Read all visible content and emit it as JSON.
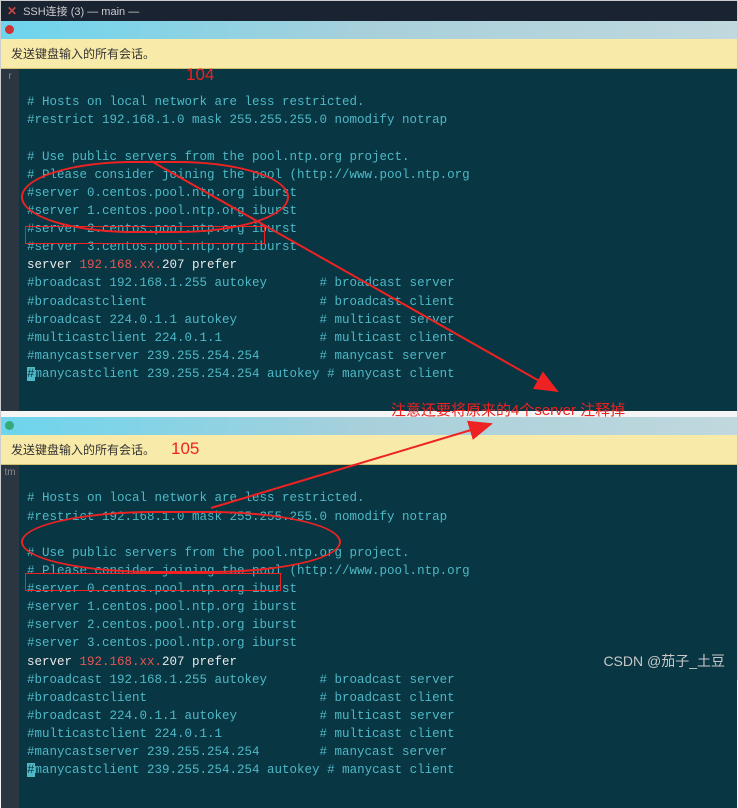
{
  "tab": {
    "title_masked": "SSH连接 (3) — main —"
  },
  "banner": {
    "text": "发送键盘输入的所有会话。"
  },
  "labels": {
    "n104": "104",
    "n105": "105"
  },
  "annotation": {
    "note": "注意还要将原来的4个server 注释掉"
  },
  "term_top": {
    "l1": "# Hosts on local network are less restricted.",
    "l2": "#restrict 192.168.1.0 mask 255.255.255.0 nomodify notrap",
    "l3": "",
    "l4": "# Use public servers from the pool.ntp.org project.",
    "l5": "# Please consider joining the pool (http://www.pool.ntp.org",
    "l6": "#server 0.centos.pool.ntp.org iburst",
    "l7": "#server 1.centos.pool.ntp.org iburst",
    "l8": "#server 2.centos.pool.ntp.org iburst",
    "l9": "#server 3.centos.pool.ntp.org iburst",
    "l10a": "server ",
    "l10b": "192.168.xx.",
    "l10c": "207 prefer",
    "l11": "#broadcast 192.168.1.255 autokey       # broadcast server",
    "l12": "#broadcastclient                       # broadcast client",
    "l13": "#broadcast 224.0.1.1 autokey           # multicast server",
    "l14": "#multicastclient 224.0.1.1             # multicast client",
    "l15": "#manycastserver 239.255.254.254        # manycast server",
    "l16a": "#",
    "l16b": "manycastclient 239.255.254.254 autokey # manycast client"
  },
  "term_bot": {
    "l1": "# Hosts on local network are less restricted.",
    "l2": "#restrict 192.168.1.0 mask 255.255.255.0 nomodify notrap",
    "l3": "",
    "l4": "# Use public servers from the pool.ntp.org project.",
    "l5": "# Please consider joining the pool (http://www.pool.ntp.org",
    "l6": "#server 0.centos.pool.ntp.org iburst",
    "l7": "#server 1.centos.pool.ntp.org iburst",
    "l8": "#server 2.centos.pool.ntp.org iburst",
    "l9": "#server 3.centos.pool.ntp.org iburst",
    "l10a": "server ",
    "l10b": "192.168.xx.",
    "l10c": "207 prefer",
    "l11": "#broadcast 192.168.1.255 autokey       # broadcast server",
    "l12": "#broadcastclient                       # broadcast client",
    "l13": "#broadcast 224.0.1.1 autokey           # multicast server",
    "l14": "#multicastclient 224.0.1.1             # multicast client",
    "l15": "#manycastserver 239.255.254.254        # manycast server",
    "l16a": "#",
    "l16b": "manycastclient 239.255.254.254 autokey # manycast client"
  },
  "gutter": {
    "r": "r",
    "tm": "tm"
  },
  "watermark": "CSDN @茄子_土豆"
}
